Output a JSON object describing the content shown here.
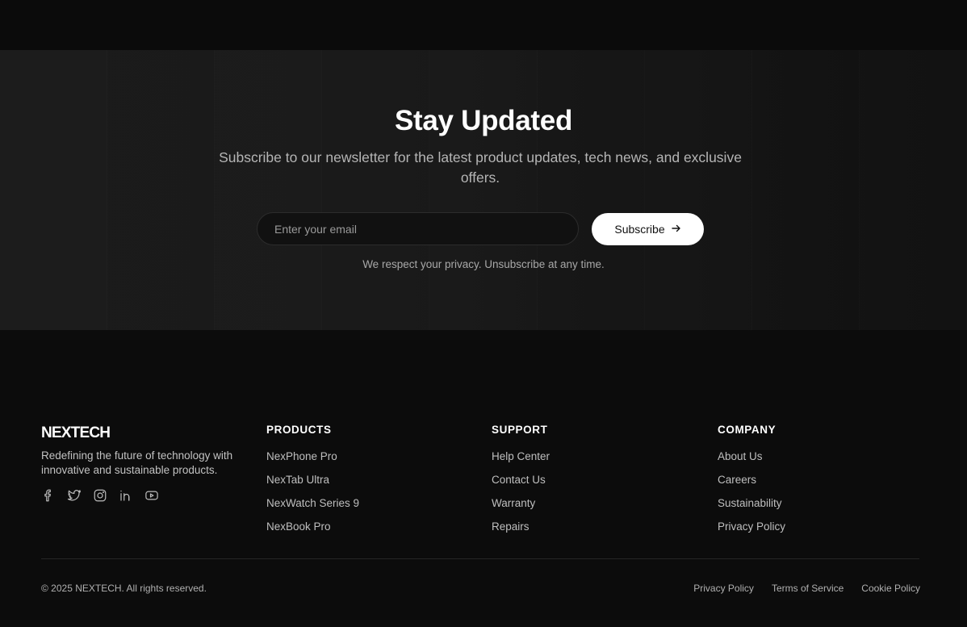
{
  "newsletter": {
    "title": "Stay Updated",
    "subtitle": "Subscribe to our newsletter for the latest product updates, tech news, and exclusive offers.",
    "email_placeholder": "Enter your email",
    "button_label": "Subscribe",
    "privacy_note": "We respect your privacy. Unsubscribe at any time."
  },
  "footer": {
    "brand": "NEXTECH",
    "tagline": "Redefining the future of technology with innovative and sustainable products.",
    "socials": [
      "facebook-icon",
      "twitter-icon",
      "instagram-icon",
      "linkedin-icon",
      "youtube-icon"
    ],
    "columns": [
      {
        "heading": "PRODUCTS",
        "links": [
          "NexPhone Pro",
          "NexTab Ultra",
          "NexWatch Series 9",
          "NexBook Pro"
        ]
      },
      {
        "heading": "SUPPORT",
        "links": [
          "Help Center",
          "Contact Us",
          "Warranty",
          "Repairs"
        ]
      },
      {
        "heading": "COMPANY",
        "links": [
          "About Us",
          "Careers",
          "Sustainability",
          "Privacy Policy"
        ]
      }
    ],
    "copyright": "© 2025 NEXTECH. All rights reserved.",
    "legal_links": [
      "Privacy Policy",
      "Terms of Service",
      "Cookie Policy"
    ]
  },
  "colors": {
    "background": "#0c0c0c",
    "button_bg": "#ffffff",
    "muted_text": "#bfbfbf"
  }
}
